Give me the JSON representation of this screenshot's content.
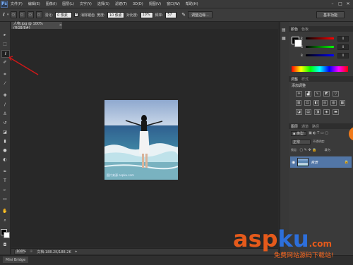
{
  "app": {
    "logo": "Ps"
  },
  "menu": [
    "文件(F)",
    "编辑(E)",
    "图像(I)",
    "图层(L)",
    "文字(Y)",
    "选择(S)",
    "滤镜(T)",
    "3D(D)",
    "视图(V)",
    "窗口(W)",
    "帮助(H)"
  ],
  "options": {
    "feather_label": "羽化:",
    "feather_value": "0 像素",
    "antialias_label": "消除锯齿",
    "width_label": "宽度:",
    "width_value": "10 像素",
    "contrast_label": "对比度:",
    "contrast_value": "10%",
    "frequency_label": "频率:",
    "frequency_value": "57",
    "refine_button": "调整边缘...",
    "workspace": "基本功能"
  },
  "document_tab": "人物.jpg @ 100%(RGB/8#)",
  "status": {
    "zoom": "100%",
    "doc_size": "文档:188.2K/188.2K"
  },
  "bottom_tab": "Mini Bridge",
  "panels": {
    "color_tab": "颜色",
    "swatches_tab": "色板",
    "r_value": "0",
    "g_value": "0",
    "b_value": "0",
    "adjust_tab": "调整",
    "styles_tab": "样式",
    "adjust_title": "添加调整",
    "layers_tab": "图层",
    "channels_tab": "通道",
    "paths_tab": "路径",
    "blend_mode": "正常",
    "opacity_label": "不透明度:",
    "lock_label": "锁定:",
    "fill_label": "填充:",
    "layer_name": "背景"
  },
  "photo": {
    "credit": "图片来源 aspku.com"
  },
  "watermark": {
    "brand_left": "asp",
    "brand_right": "ku",
    "tld": ".com",
    "subtitle": "免费网站源码下载站!"
  },
  "colors": {
    "accent": "#e55a1b",
    "layer_selected": "#5276a6"
  }
}
